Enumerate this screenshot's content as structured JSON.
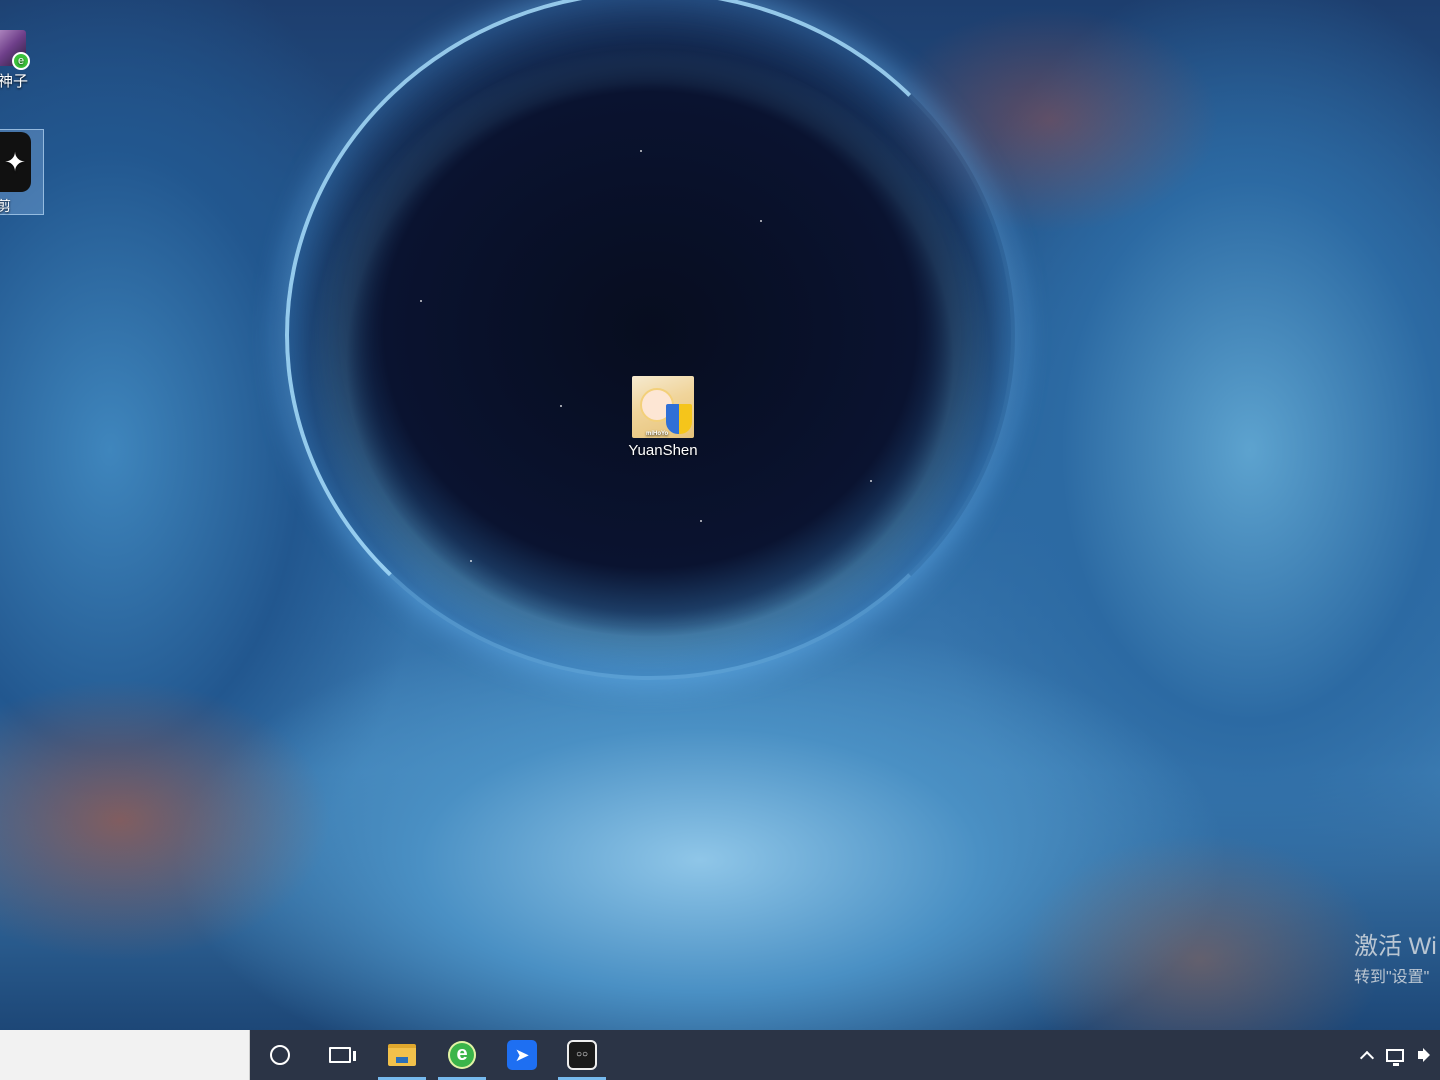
{
  "desktop": {
    "icons": [
      {
        "label": "神子",
        "icon": "app-shortcut-icon"
      },
      {
        "label": "剪",
        "icon": "video-editor-icon"
      },
      {
        "label": "YuanShen",
        "icon": "yuanshen-game-icon",
        "publisher_mark": "miHoYo"
      }
    ]
  },
  "watermark": {
    "line1": "激活 Wi",
    "line2": "转到\"设置\""
  },
  "taskbar": {
    "search_placeholder": "",
    "buttons": [
      {
        "name": "cortana",
        "icon": "cortana-icon",
        "running": false
      },
      {
        "name": "task-view",
        "icon": "task-view-icon",
        "running": false
      },
      {
        "name": "file-explorer",
        "icon": "folder-icon",
        "running": true
      },
      {
        "name": "browser",
        "icon": "ie-browser-icon",
        "running": true
      },
      {
        "name": "feishu",
        "icon": "bird-app-icon",
        "running": false
      },
      {
        "name": "bilibili",
        "icon": "bilibili-icon",
        "running": true
      }
    ],
    "tray": [
      "chevron-up-icon",
      "network-icon",
      "volume-icon"
    ]
  },
  "colors": {
    "taskbar_bg": "#2b3446",
    "running_indicator": "#76b9ed",
    "search_bg": "#f2f2f2"
  }
}
